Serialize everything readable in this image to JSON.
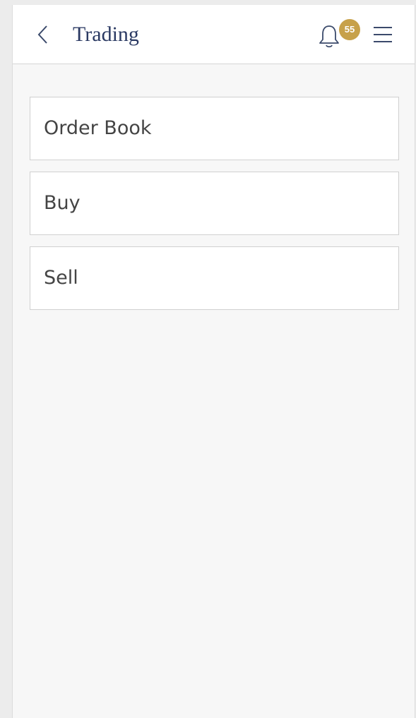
{
  "header": {
    "title": "Trading",
    "back_icon": "chevron-left-icon",
    "bell_icon": "bell-icon",
    "menu_icon": "hamburger-menu-icon",
    "notification_count": "55"
  },
  "menu": {
    "items": [
      {
        "label": "Order Book"
      },
      {
        "label": "Buy"
      },
      {
        "label": "Sell"
      }
    ]
  },
  "colors": {
    "title": "#2b3a63",
    "badge": "#c7a14a",
    "background": "#f7f7f7"
  }
}
